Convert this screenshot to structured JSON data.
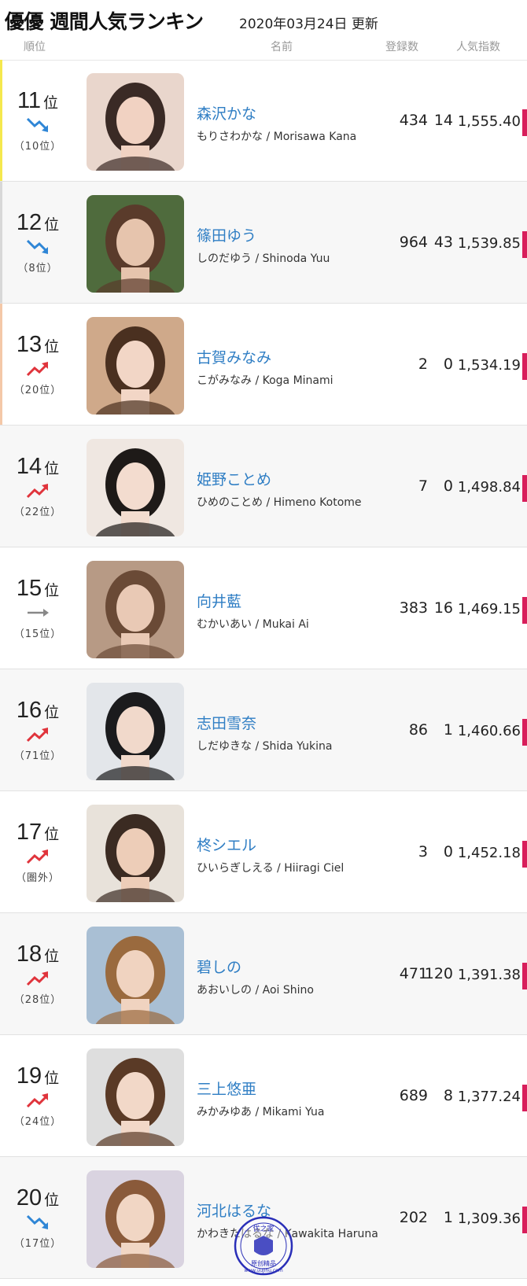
{
  "header": {
    "title": "優優 週間人気ランキン",
    "date": "2020年03月24日 更新"
  },
  "columns": {
    "rank": "順位",
    "name": "名前",
    "registrations": "登録数",
    "popularity": "人気指数"
  },
  "colors": {
    "link": "#2f7ec4",
    "up": "#e0343c",
    "down": "#2f86d6",
    "flat": "#888888",
    "bar": "#d81e5b"
  },
  "rows": [
    {
      "rank": "11",
      "suffix": "位",
      "trend": "down",
      "prev": "（10位）",
      "name": "森沢かな",
      "reading": "もりさわかな / Morisawa Kana",
      "reg": "434",
      "diff": "14",
      "index": "1,555.40",
      "edge": "#f5e84e"
    },
    {
      "rank": "12",
      "suffix": "位",
      "trend": "down",
      "prev": "（8位）",
      "name": "篠田ゆう",
      "reading": "しのだゆう / Shinoda Yuu",
      "reg": "964",
      "diff": "43",
      "index": "1,539.85",
      "edge": "#d8d8d8"
    },
    {
      "rank": "13",
      "suffix": "位",
      "trend": "up",
      "prev": "（20位）",
      "name": "古賀みなみ",
      "reading": "こがみなみ / Koga Minami",
      "reg": "2",
      "diff": "0",
      "index": "1,534.19",
      "edge": "#f4c8a8"
    },
    {
      "rank": "14",
      "suffix": "位",
      "trend": "up",
      "prev": "（22位）",
      "name": "姫野ことめ",
      "reading": "ひめのことめ / Himeno Kotome",
      "reg": "7",
      "diff": "0",
      "index": "1,498.84",
      "edge": ""
    },
    {
      "rank": "15",
      "suffix": "位",
      "trend": "flat",
      "prev": "（15位）",
      "name": "向井藍",
      "reading": "むかいあい / Mukai Ai",
      "reg": "383",
      "diff": "16",
      "index": "1,469.15",
      "edge": ""
    },
    {
      "rank": "16",
      "suffix": "位",
      "trend": "up",
      "prev": "（71位）",
      "name": "志田雪奈",
      "reading": "しだゆきな / Shida Yukina",
      "reg": "86",
      "diff": "1",
      "index": "1,460.66",
      "edge": ""
    },
    {
      "rank": "17",
      "suffix": "位",
      "trend": "up",
      "prev": "（圏外）",
      "name": "柊シエル",
      "reading": "ひいらぎしえる / Hiiragi Ciel",
      "reg": "3",
      "diff": "0",
      "index": "1,452.18",
      "edge": ""
    },
    {
      "rank": "18",
      "suffix": "位",
      "trend": "up",
      "prev": "（28位）",
      "name": "碧しの",
      "reading": "あおいしの / Aoi Shino",
      "reg": "471",
      "diff": "120",
      "index": "1,391.38",
      "edge": ""
    },
    {
      "rank": "19",
      "suffix": "位",
      "trend": "up",
      "prev": "（24位）",
      "name": "三上悠亜",
      "reading": "みかみゆあ / Mikami Yua",
      "reg": "689",
      "diff": "8",
      "index": "1,377.24",
      "edge": ""
    },
    {
      "rank": "20",
      "suffix": "位",
      "trend": "down",
      "prev": "（17位）",
      "name": "河北はるな",
      "reading": "かわきたはるな / Kawakita Haruna",
      "reg": "202",
      "diff": "1",
      "index": "1,309.36",
      "edge": ""
    }
  ],
  "watermark": {
    "top_text": "优之家",
    "bottom_text": "原创精品",
    "url": "www.uujihu.com"
  }
}
